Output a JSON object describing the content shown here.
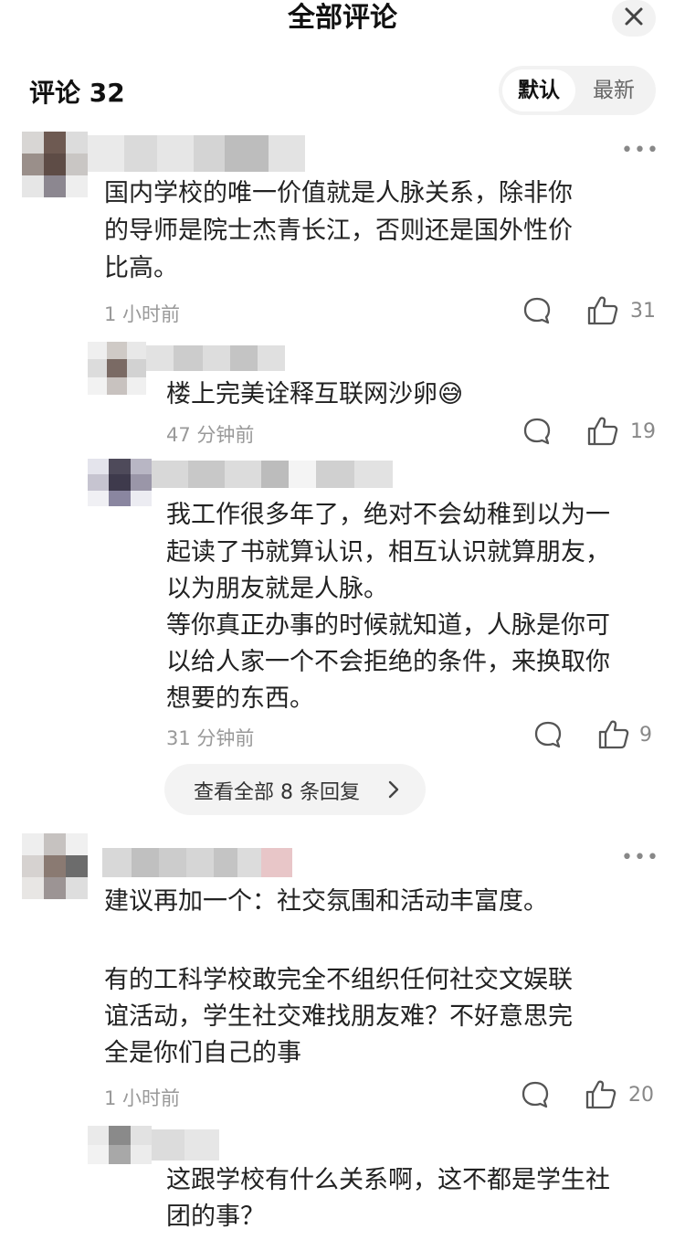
{
  "header": {
    "title": "全部评论",
    "close_icon": "close-icon"
  },
  "summary": {
    "count_label": "评论 32"
  },
  "sort": {
    "default_label": "默认",
    "latest_label": "最新",
    "selected": "默认"
  },
  "comments": [
    {
      "more": "•••",
      "text_lines": [
        "国内学校的唯一价值就是人脉关系，除非你",
        "的导师是院士杰青长江，否则还是国外性价",
        "比高。"
      ],
      "time": "1 小时前",
      "likes": "31",
      "replies": [
        {
          "text_lines": [
            "楼上完美诠释互联网沙卵😅"
          ],
          "time": "47 分钟前",
          "likes": "19"
        },
        {
          "text_lines": [
            "我工作很多年了，绝对不会幼稚到以为一",
            "起读了书就算认识，相互认识就算朋友，",
            "以为朋友就是人脉。",
            "等你真正办事的时候就知道，人脉是你可",
            "以给人家一个不会拒绝的条件，来换取你",
            "想要的东西。"
          ],
          "time": "31 分钟前",
          "likes": "9"
        }
      ],
      "view_all": "查看全部 8 条回复"
    },
    {
      "more": "•••",
      "text_lines": [
        "建议再加一个：社交氛围和活动丰富度。",
        "",
        "有的工科学校敢完全不组织任何社交文娱联",
        "谊活动，学生社交难找朋友难？不好意思完",
        "全是你们自己的事"
      ],
      "time": "1 小时前",
      "likes": "20",
      "replies": [
        {
          "text_lines": [
            "这跟学校有什么关系啊，这不都是学生社",
            "团的事？"
          ]
        }
      ]
    }
  ],
  "icons": {
    "comment": "comment-bubble-icon",
    "like": "thumbs-up-icon",
    "chevron": "chevron-right-icon"
  },
  "colors": {
    "background": "#ffffff",
    "text": "#222222",
    "meta": "#999999",
    "pill": "#f3f3f3"
  }
}
